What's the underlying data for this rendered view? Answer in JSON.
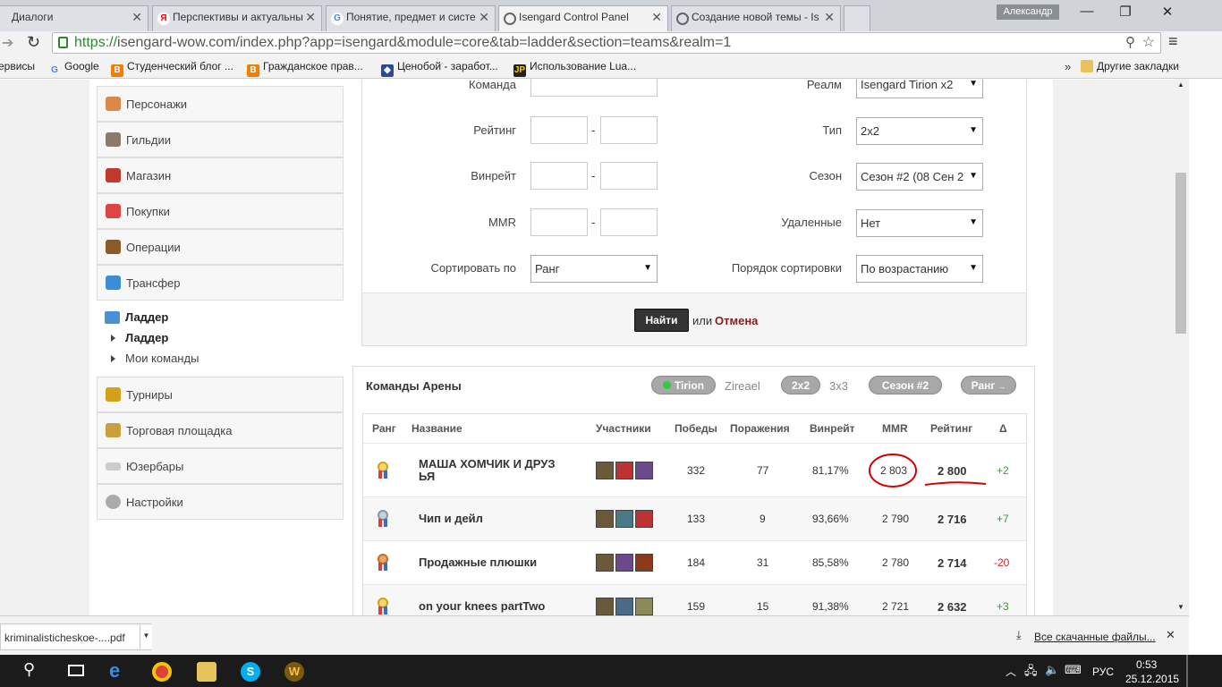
{
  "tabs": [
    {
      "label": "Диалоги",
      "icon": "chat-icon",
      "x": 0
    },
    {
      "label": "Перспективы и актуальны",
      "icon": "yandex-icon"
    },
    {
      "label": "Понятие, предмет и систе",
      "icon": "google-icon"
    },
    {
      "label": "Isengard Control Panel",
      "icon": "globe-icon"
    },
    {
      "label": "Создание новой темы - Is",
      "icon": "globe-icon"
    }
  ],
  "window": {
    "user": "Александр"
  },
  "url": {
    "proto": "https://",
    "rest": "isengard-wow.com/index.php?app=isengard&module=core&tab=ladder&section=teams&realm=1"
  },
  "bookmarks": [
    {
      "label": "ервисы"
    },
    {
      "label": "Google"
    },
    {
      "label": "Студенческий блог ..."
    },
    {
      "label": "Гражданское прав..."
    },
    {
      "label": "Ценобой - заработ..."
    },
    {
      "label": "Использование Lua..."
    },
    {
      "label": "Другие закладки"
    }
  ],
  "sidebar": {
    "items": [
      "Персонажи",
      "Гильдии",
      "Магазин",
      "Покупки",
      "Операции",
      "Трансфер"
    ],
    "ladder": {
      "title": "Ладдер",
      "sub1": "Ладдер",
      "sub2": "Мои команды"
    },
    "items2": [
      "Турниры",
      "Торговая площадка",
      "Юзербары",
      "Настройки"
    ]
  },
  "filter": {
    "team": "Команда",
    "rating": "Рейтинг",
    "winrate": "Винрейт",
    "mmr": "MMR",
    "sort_by": "Сортировать по",
    "realm": "Реалм",
    "type": "Тип",
    "season": "Сезон",
    "deleted": "Удаленные",
    "sort_order": "Порядок сортировки",
    "realm_val": "Isengard Tirion x2",
    "type_val": "2x2",
    "season_val": "Сезон #2 (08 Сен 2",
    "deleted_val": "Нет",
    "sort_val": "Ранг",
    "order_val": "По возрастанию",
    "dash": "-",
    "find": "Найти",
    "or": "или",
    "cancel": "Отмена"
  },
  "teams": {
    "title": "Команды Арены",
    "realm1": "Tirion",
    "realm2": "Zireael",
    "b2": "2x2",
    "b3": "3x3",
    "season": "Сезон #2",
    "rank": "Ранг"
  },
  "table": {
    "headers": [
      "Ранг",
      "Название",
      "Участники",
      "Победы",
      "Поражения",
      "Винрейт",
      "MMR",
      "Рейтинг",
      "Δ"
    ],
    "rows": [
      {
        "name": "МАША ХОМЧИК И ДРУЗ ЬЯ",
        "wins": "332",
        "losses": "77",
        "winrate": "81,17%",
        "mmr": "2 803",
        "rating": "2 800",
        "delta": "+2"
      },
      {
        "name": "Чип и дейл",
        "wins": "133",
        "losses": "9",
        "winrate": "93,66%",
        "mmr": "2 790",
        "rating": "2 716",
        "delta": "+7"
      },
      {
        "name": "Продажные плюшки",
        "wins": "184",
        "losses": "31",
        "winrate": "85,58%",
        "mmr": "2 780",
        "rating": "2 714",
        "delta": "-20"
      },
      {
        "name": "on your knees partTwo",
        "wins": "159",
        "losses": "15",
        "winrate": "91,38%",
        "mmr": "2 721",
        "rating": "2 632",
        "delta": "+3"
      }
    ]
  },
  "downloads": {
    "file": "kriminalisticheskoe-....pdf",
    "all": "Все скачанные файлы..."
  },
  "taskbar": {
    "lang": "РУС",
    "time": "0:53",
    "date": "25.12.2015"
  },
  "colors": {
    "positive": "#3a9a3a",
    "negative": "#cc2222",
    "annotation": "#d40000"
  }
}
